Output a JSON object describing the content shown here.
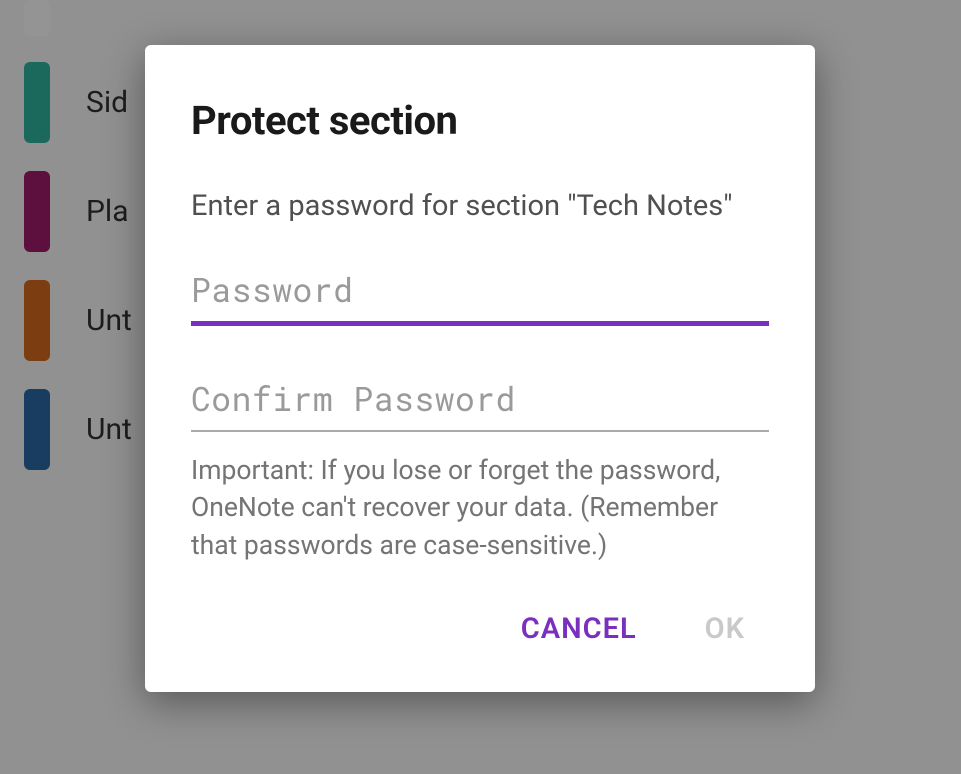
{
  "sections": [
    {
      "label": "",
      "color": "#ffffff"
    },
    {
      "label": "Sid",
      "color": "#2fb5a0"
    },
    {
      "label": "Pla",
      "color": "#a01a6a"
    },
    {
      "label": "Unt",
      "color": "#d66b1e"
    },
    {
      "label": "Unt",
      "color": "#2a6aa8"
    }
  ],
  "dialog": {
    "title": "Protect section",
    "prompt": "Enter a password for section \"Tech Notes\"",
    "password_placeholder": "Password",
    "confirm_placeholder": "Confirm Password",
    "warning": "Important: If you lose or forget the password, OneNote can't recover your data. (Remember that passwords are case-sensitive.)",
    "cancel": "CANCEL",
    "ok": "OK"
  }
}
